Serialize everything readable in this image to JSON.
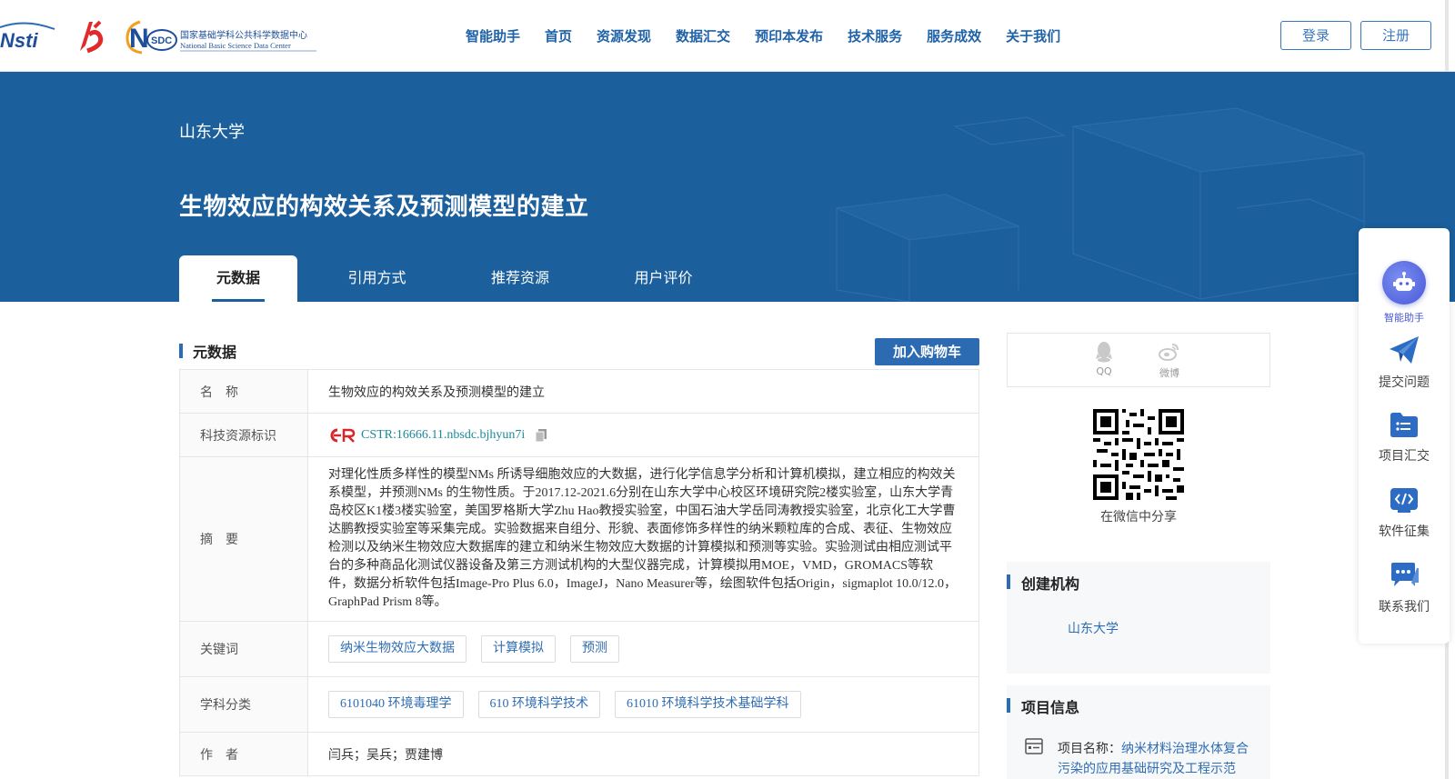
{
  "header": {
    "nav": [
      "智能助手",
      "首页",
      "资源发现",
      "数据汇交",
      "预印本发布",
      "技术服务",
      "服务成效",
      "关于我们"
    ],
    "login": "登录",
    "register": "注册",
    "logo_cstr_text": "Nsti",
    "logo_nsdc_cn": "国家基础学科公共科学数据中心",
    "logo_nsdc_en": "National Basic Science Data Center"
  },
  "banner": {
    "org": "山东大学",
    "title": "生物效应的构效关系及预测模型的建立",
    "tabs": [
      "元数据",
      "引用方式",
      "推荐资源",
      "用户评价"
    ]
  },
  "section": {
    "title": "元数据",
    "add_cart": "加入购物车"
  },
  "meta": {
    "name_label": "名　称",
    "name_value": "生物效应的构效关系及预测模型的建立",
    "id_label": "科技资源标识",
    "id_value": "CSTR:16666.11.nbsdc.bjhyun7i",
    "abstract_label": "摘　要",
    "abstract_value": "对理化性质多样性的模型NMs 所诱导细胞效应的大数据，进行化学信息学分析和计算机模拟，建立相应的构效关系模型，并预测NMs 的生物性质。于2017.12-2021.6分别在山东大学中心校区环境研究院2楼实验室，山东大学青岛校区K1楼3楼实验室，美国罗格斯大学Zhu Hao教授实验室，中国石油大学岳同涛教授实验室，北京化工大学曹达鹏教授实验室等采集完成。实验数据来自组分、形貌、表面修饰多样性的纳米颗粒库的合成、表征、生物效应检测以及纳米生物效应大数据库的建立和纳米生物效应大数据的计算模拟和预测等实验。实验测试由相应测试平台的多种商品化测试仪器设备及第三方测试机构的大型仪器完成，计算模拟用MOE，VMD，GROMACS等软件，数据分析软件包括Image-Pro Plus 6.0，ImageJ，Nano Measurer等，绘图软件包括Origin，sigmaplot 10.0/12.0，GraphPad Prism 8等。",
    "keywords_label": "关键词",
    "keywords": [
      "纳米生物效应大数据",
      "计算模拟",
      "预测"
    ],
    "subjects_label": "学科分类",
    "subjects": [
      "6101040 环境毒理学",
      "610 环境科学技术",
      "61010 环境科学技术基础学科"
    ],
    "authors_label": "作　者",
    "authors_value": "闫兵；吴兵；贾建博"
  },
  "share": {
    "qq": "QQ",
    "weibo": "微博",
    "wechat": "在微信中分享"
  },
  "org_card": {
    "title": "创建机构",
    "org": "山东大学"
  },
  "project_card": {
    "title": "项目信息",
    "label": "项目名称：",
    "value": "纳米材料治理水体复合污染的应用基础研究及工程示范"
  },
  "float_panel": {
    "assistant": "智能助手",
    "submit": "提交问题",
    "project": "项目汇交",
    "software": "软件征集",
    "contact": "联系我们"
  },
  "colors": {
    "brand": "#1b5f9c",
    "accent": "#2c6bb2",
    "link": "#2f6db4"
  }
}
